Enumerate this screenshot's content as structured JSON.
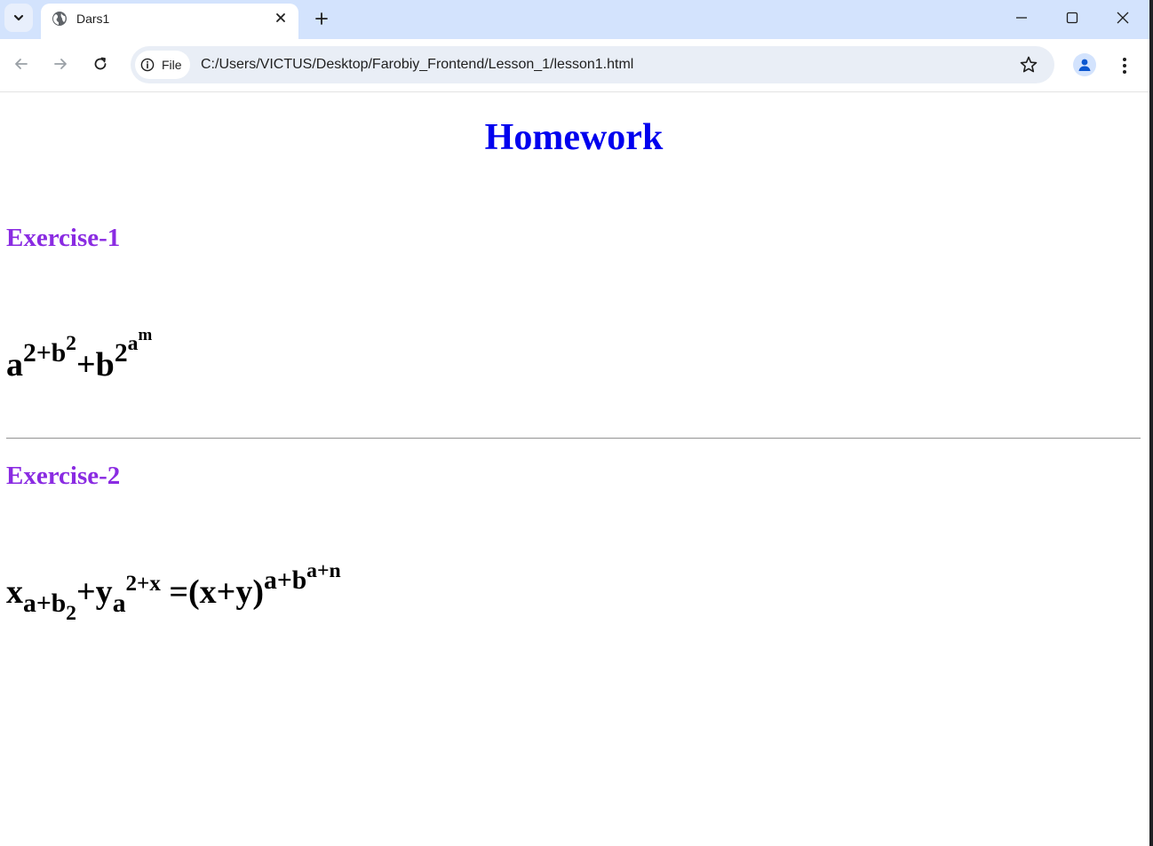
{
  "browser": {
    "tab": {
      "title": "Dars1"
    },
    "omnibox": {
      "chip_label": "File",
      "url": "C:/Users/VICTUS/Desktop/Farobiy_Frontend/Lesson_1/lesson1.html"
    }
  },
  "page": {
    "title": "Homework",
    "exercise1": {
      "heading": "Exercise-1",
      "formula": {
        "p1_base": "a",
        "p1_sup_a": "2+b",
        "p1_sup_b": "2",
        "p2_base": "+b",
        "p2_sup_a": "2",
        "p2_sup_b": "a",
        "p2_sup_c": "m"
      }
    },
    "exercise2": {
      "heading": "Exercise-2",
      "formula": {
        "x_base": "x",
        "x_sub_a": "a+b",
        "x_sub_b": "2",
        "y_base": "+y",
        "y_sub": "a",
        "y_sup": "2+x",
        "rhs": " =(x+y)",
        "rhs_sup_a": "a+b",
        "rhs_sup_b": "a+n"
      }
    }
  },
  "colors": {
    "title": "#0000ee",
    "exercise_heading": "#8a2be2",
    "tabstrip": "#d3e3fd",
    "omnibox": "#e9eef6"
  }
}
